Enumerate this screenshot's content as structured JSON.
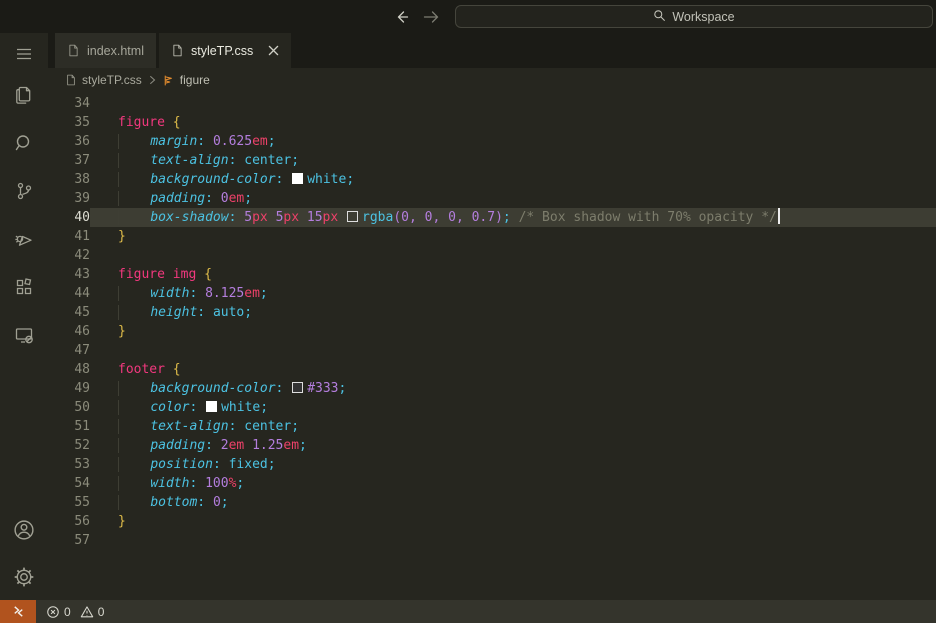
{
  "window": {
    "command_center_label": "Workspace"
  },
  "tabs": [
    {
      "label": "index.html",
      "active": false
    },
    {
      "label": "styleTP.css",
      "active": true
    }
  ],
  "breadcrumb": {
    "file": "styleTP.css",
    "symbol": "figure"
  },
  "activity_bar_icons": [
    "menu-icon",
    "explorer-icon",
    "search-icon",
    "source-control-icon",
    "run-debug-icon",
    "extensions-icon",
    "remote-explorer-icon",
    "account-icon",
    "settings-gear-icon"
  ],
  "editor": {
    "active_line": 40,
    "lines": [
      {
        "n": 34,
        "tokens": []
      },
      {
        "n": 35,
        "tokens": [
          [
            "sel",
            "figure"
          ],
          [
            "pl",
            " "
          ],
          [
            "br",
            "{"
          ]
        ]
      },
      {
        "n": 36,
        "tokens": [
          [
            "ind",
            "    "
          ],
          [
            "prop",
            "margin"
          ],
          [
            "pu",
            ":"
          ],
          [
            "pl",
            " "
          ],
          [
            "num",
            "0.625"
          ],
          [
            "un",
            "em"
          ],
          [
            "pu",
            ";"
          ]
        ]
      },
      {
        "n": 37,
        "tokens": [
          [
            "ind",
            "    "
          ],
          [
            "prop",
            "text-align"
          ],
          [
            "pu",
            ":"
          ],
          [
            "pl",
            " "
          ],
          [
            "val",
            "center"
          ],
          [
            "pu",
            ";"
          ]
        ]
      },
      {
        "n": 38,
        "tokens": [
          [
            "ind",
            "    "
          ],
          [
            "prop",
            "background-color"
          ],
          [
            "pu",
            ":"
          ],
          [
            "pl",
            " "
          ],
          [
            "swW",
            ""
          ],
          [
            "val",
            "white"
          ],
          [
            "pu",
            ";"
          ]
        ]
      },
      {
        "n": 39,
        "tokens": [
          [
            "ind",
            "    "
          ],
          [
            "prop",
            "padding"
          ],
          [
            "pu",
            ":"
          ],
          [
            "pl",
            " "
          ],
          [
            "num",
            "0"
          ],
          [
            "un",
            "em"
          ],
          [
            "pu",
            ";"
          ]
        ]
      },
      {
        "n": 40,
        "cursor": true,
        "tokens": [
          [
            "ind",
            "    "
          ],
          [
            "prop",
            "box-shadow"
          ],
          [
            "pu",
            ":"
          ],
          [
            "pl",
            " "
          ],
          [
            "num",
            "5"
          ],
          [
            "un",
            "px"
          ],
          [
            "pl",
            " "
          ],
          [
            "num",
            "5"
          ],
          [
            "un",
            "px"
          ],
          [
            "pl",
            " "
          ],
          [
            "num",
            "15"
          ],
          [
            "un",
            "px"
          ],
          [
            "pl",
            " "
          ],
          [
            "swD",
            ""
          ],
          [
            "fn",
            "rgba"
          ],
          [
            "pn",
            "("
          ],
          [
            "num",
            "0"
          ],
          [
            "pn",
            ","
          ],
          [
            "pl",
            " "
          ],
          [
            "num",
            "0"
          ],
          [
            "pn",
            ","
          ],
          [
            "pl",
            " "
          ],
          [
            "num",
            "0"
          ],
          [
            "pn",
            ","
          ],
          [
            "pl",
            " "
          ],
          [
            "num",
            "0.7"
          ],
          [
            "pn",
            ")"
          ],
          [
            "pu",
            ";"
          ],
          [
            "pl",
            " "
          ],
          [
            "cm",
            "/* Box shadow with 70% opacity */"
          ]
        ]
      },
      {
        "n": 41,
        "tokens": [
          [
            "br",
            "}"
          ]
        ]
      },
      {
        "n": 42,
        "tokens": []
      },
      {
        "n": 43,
        "tokens": [
          [
            "sel",
            "figure"
          ],
          [
            "pl",
            " "
          ],
          [
            "sel",
            "img"
          ],
          [
            "pl",
            " "
          ],
          [
            "br",
            "{"
          ]
        ]
      },
      {
        "n": 44,
        "tokens": [
          [
            "ind",
            "    "
          ],
          [
            "prop",
            "width"
          ],
          [
            "pu",
            ":"
          ],
          [
            "pl",
            " "
          ],
          [
            "num",
            "8.125"
          ],
          [
            "un",
            "em"
          ],
          [
            "pu",
            ";"
          ]
        ]
      },
      {
        "n": 45,
        "tokens": [
          [
            "ind",
            "    "
          ],
          [
            "prop",
            "height"
          ],
          [
            "pu",
            ":"
          ],
          [
            "pl",
            " "
          ],
          [
            "val",
            "auto"
          ],
          [
            "pu",
            ";"
          ]
        ]
      },
      {
        "n": 46,
        "tokens": [
          [
            "br",
            "}"
          ]
        ]
      },
      {
        "n": 47,
        "tokens": []
      },
      {
        "n": 48,
        "tokens": [
          [
            "sel",
            "footer"
          ],
          [
            "pl",
            " "
          ],
          [
            "br",
            "{"
          ]
        ]
      },
      {
        "n": 49,
        "tokens": [
          [
            "ind",
            "    "
          ],
          [
            "prop",
            "background-color"
          ],
          [
            "pu",
            ":"
          ],
          [
            "pl",
            " "
          ],
          [
            "sw3",
            ""
          ],
          [
            "num",
            "#333"
          ],
          [
            "pu",
            ";"
          ]
        ]
      },
      {
        "n": 50,
        "tokens": [
          [
            "ind",
            "    "
          ],
          [
            "prop",
            "color"
          ],
          [
            "pu",
            ":"
          ],
          [
            "pl",
            " "
          ],
          [
            "swW",
            ""
          ],
          [
            "val",
            "white"
          ],
          [
            "pu",
            ";"
          ]
        ]
      },
      {
        "n": 51,
        "tokens": [
          [
            "ind",
            "    "
          ],
          [
            "prop",
            "text-align"
          ],
          [
            "pu",
            ":"
          ],
          [
            "pl",
            " "
          ],
          [
            "val",
            "center"
          ],
          [
            "pu",
            ";"
          ]
        ]
      },
      {
        "n": 52,
        "tokens": [
          [
            "ind",
            "    "
          ],
          [
            "prop",
            "padding"
          ],
          [
            "pu",
            ":"
          ],
          [
            "pl",
            " "
          ],
          [
            "num",
            "2"
          ],
          [
            "un",
            "em"
          ],
          [
            "pl",
            " "
          ],
          [
            "num",
            "1.25"
          ],
          [
            "un",
            "em"
          ],
          [
            "pu",
            ";"
          ]
        ]
      },
      {
        "n": 53,
        "tokens": [
          [
            "ind",
            "    "
          ],
          [
            "prop",
            "position"
          ],
          [
            "pu",
            ":"
          ],
          [
            "pl",
            " "
          ],
          [
            "val",
            "fixed"
          ],
          [
            "pu",
            ";"
          ]
        ]
      },
      {
        "n": 54,
        "tokens": [
          [
            "ind",
            "    "
          ],
          [
            "prop",
            "width"
          ],
          [
            "pu",
            ":"
          ],
          [
            "pl",
            " "
          ],
          [
            "num",
            "100"
          ],
          [
            "un",
            "%"
          ],
          [
            "pu",
            ";"
          ]
        ]
      },
      {
        "n": 55,
        "tokens": [
          [
            "ind",
            "    "
          ],
          [
            "prop",
            "bottom"
          ],
          [
            "pu",
            ":"
          ],
          [
            "pl",
            " "
          ],
          [
            "num",
            "0"
          ],
          [
            "pu",
            ";"
          ]
        ]
      },
      {
        "n": 56,
        "tokens": [
          [
            "br",
            "}"
          ]
        ]
      },
      {
        "n": 57,
        "tokens": []
      }
    ]
  },
  "status_bar": {
    "errors": "0",
    "warnings": "0"
  },
  "colors": {
    "titlebar_bg": "#1b1b16",
    "editor_bg": "#26261f",
    "tab_inactive_bg": "#2d2d26",
    "statusbar_bg": "#34342c",
    "remote_badge_bg": "#b1531e",
    "current_line_bg": "#3d3d33",
    "selector": "#f1387e",
    "brace": "#e0bd4a",
    "property": "#4cc2e2",
    "number": "#b47ede",
    "unit": "#ed4169",
    "value": "#4cc2e2",
    "comment": "#7d7d6c",
    "breadcrumb_symbol_icon": "#e08a2e"
  }
}
